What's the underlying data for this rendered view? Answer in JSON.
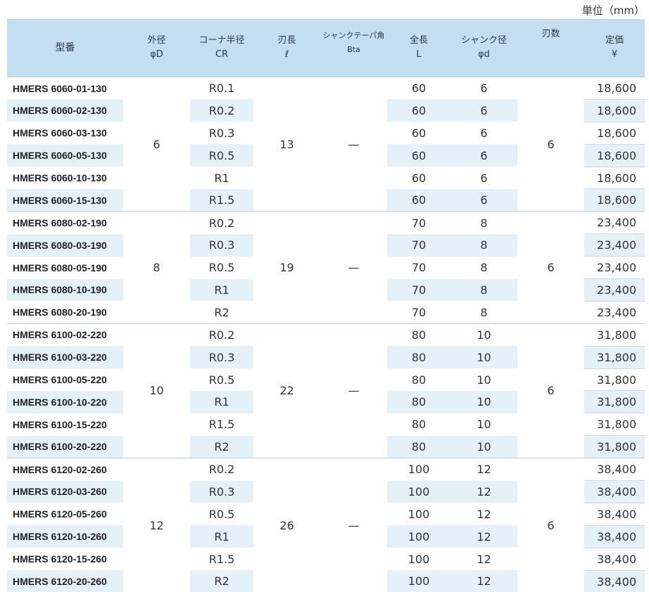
{
  "unit_label": "単位（mm）",
  "headers": {
    "model": "型番",
    "dia_1": "外径",
    "dia_2": "φD",
    "cr_1": "コーナ半径",
    "cr_2": "CR",
    "len_1": "刃長",
    "len_2": "ℓ",
    "bta_1": "シャンクテーパ角",
    "bta_2": "Bta",
    "L_1": "全長",
    "L_2": "L",
    "sd_1": "シャンク径",
    "sd_2": "φd",
    "flutes": "刃数",
    "price_1": "定価",
    "price_2": "¥"
  },
  "groups": [
    {
      "dia": "6",
      "len": "13",
      "bta": "—",
      "flutes": "6",
      "rows": [
        {
          "model": "HMERS 6060-01-130",
          "cr": "R0.1",
          "L": "60",
          "sd": "6",
          "price": "18,600"
        },
        {
          "model": "HMERS 6060-02-130",
          "cr": "R0.2",
          "L": "60",
          "sd": "6",
          "price": "18,600"
        },
        {
          "model": "HMERS 6060-03-130",
          "cr": "R0.3",
          "L": "60",
          "sd": "6",
          "price": "18,600"
        },
        {
          "model": "HMERS 6060-05-130",
          "cr": "R0.5",
          "L": "60",
          "sd": "6",
          "price": "18,600"
        },
        {
          "model": "HMERS 6060-10-130",
          "cr": "R1",
          "L": "60",
          "sd": "6",
          "price": "18,600"
        },
        {
          "model": "HMERS 6060-15-130",
          "cr": "R1.5",
          "L": "60",
          "sd": "6",
          "price": "18,600"
        }
      ]
    },
    {
      "dia": "8",
      "len": "19",
      "bta": "—",
      "flutes": "6",
      "rows": [
        {
          "model": "HMERS 6080-02-190",
          "cr": "R0.2",
          "L": "70",
          "sd": "8",
          "price": "23,400"
        },
        {
          "model": "HMERS 6080-03-190",
          "cr": "R0.3",
          "L": "70",
          "sd": "8",
          "price": "23,400"
        },
        {
          "model": "HMERS 6080-05-190",
          "cr": "R0.5",
          "L": "70",
          "sd": "8",
          "price": "23,400"
        },
        {
          "model": "HMERS 6080-10-190",
          "cr": "R1",
          "L": "70",
          "sd": "8",
          "price": "23,400"
        },
        {
          "model": "HMERS 6080-20-190",
          "cr": "R2",
          "L": "70",
          "sd": "8",
          "price": "23,400"
        }
      ]
    },
    {
      "dia": "10",
      "len": "22",
      "bta": "—",
      "flutes": "6",
      "rows": [
        {
          "model": "HMERS 6100-02-220",
          "cr": "R0.2",
          "L": "80",
          "sd": "10",
          "price": "31,800"
        },
        {
          "model": "HMERS 6100-03-220",
          "cr": "R0.3",
          "L": "80",
          "sd": "10",
          "price": "31,800"
        },
        {
          "model": "HMERS 6100-05-220",
          "cr": "R0.5",
          "L": "80",
          "sd": "10",
          "price": "31,800"
        },
        {
          "model": "HMERS 6100-10-220",
          "cr": "R1",
          "L": "80",
          "sd": "10",
          "price": "31,800"
        },
        {
          "model": "HMERS 6100-15-220",
          "cr": "R1.5",
          "L": "80",
          "sd": "10",
          "price": "31,800"
        },
        {
          "model": "HMERS 6100-20-220",
          "cr": "R2",
          "L": "80",
          "sd": "10",
          "price": "31,800"
        }
      ]
    },
    {
      "dia": "12",
      "len": "26",
      "bta": "—",
      "flutes": "6",
      "rows": [
        {
          "model": "HMERS 6120-02-260",
          "cr": "R0.2",
          "L": "100",
          "sd": "12",
          "price": "38,400"
        },
        {
          "model": "HMERS 6120-03-260",
          "cr": "R0.3",
          "L": "100",
          "sd": "12",
          "price": "38,400"
        },
        {
          "model": "HMERS 6120-05-260",
          "cr": "R0.5",
          "L": "100",
          "sd": "12",
          "price": "38,400"
        },
        {
          "model": "HMERS 6120-10-260",
          "cr": "R1",
          "L": "100",
          "sd": "12",
          "price": "38,400"
        },
        {
          "model": "HMERS 6120-15-260",
          "cr": "R1.5",
          "L": "100",
          "sd": "12",
          "price": "38,400"
        },
        {
          "model": "HMERS 6120-20-260",
          "cr": "R2",
          "L": "100",
          "sd": "12",
          "price": "38,400"
        }
      ]
    }
  ]
}
